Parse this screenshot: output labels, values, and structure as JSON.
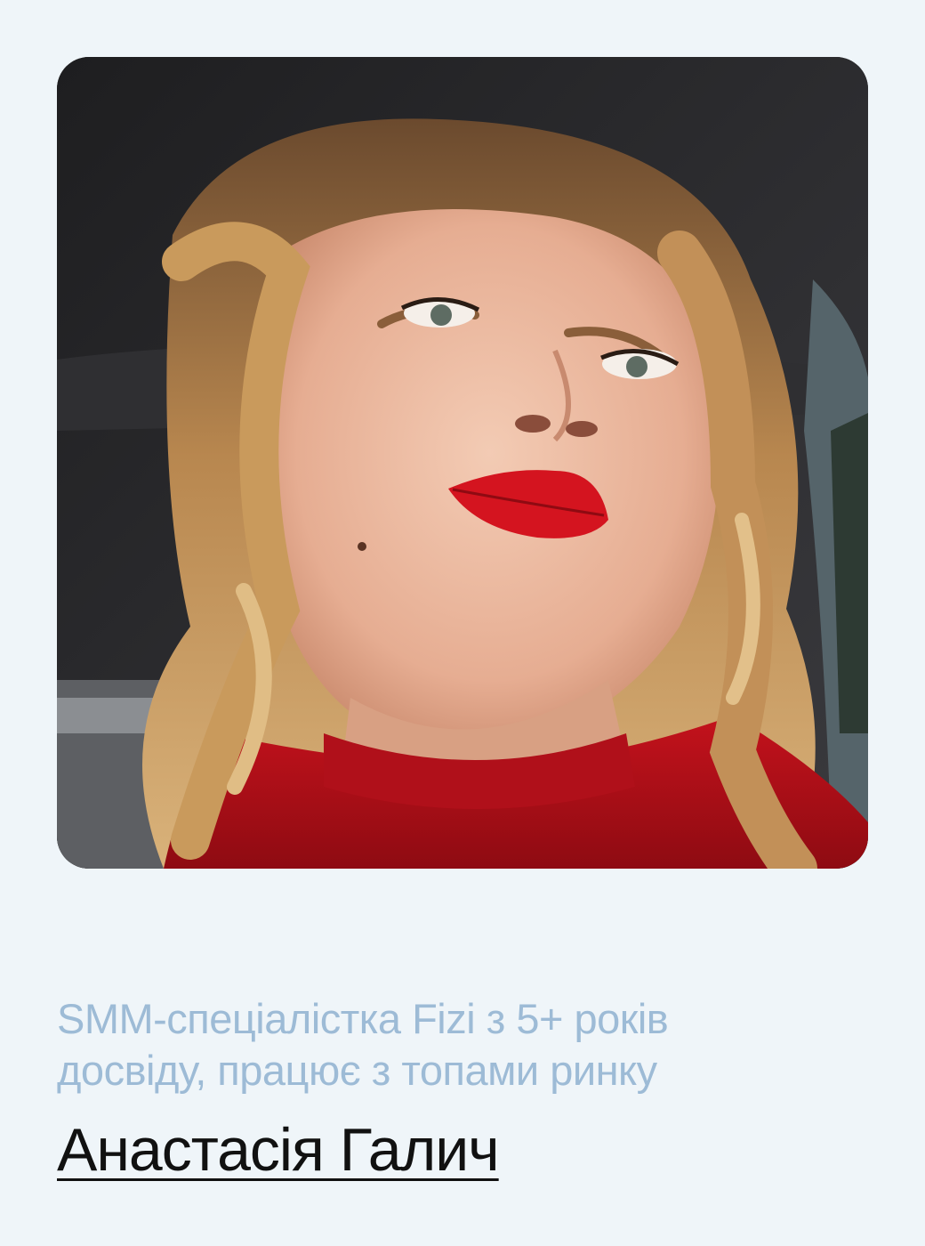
{
  "profile": {
    "photo_icon": "portrait-photo",
    "role_line1": "SMM-спеціалістка Fizi з 5+ років",
    "role_line2": "досвіду, працює з топами ринку",
    "name": "Анастасія Галич"
  },
  "colors": {
    "background": "#eff5f9",
    "role_text": "#9dbbd6",
    "name_text": "#111111"
  }
}
